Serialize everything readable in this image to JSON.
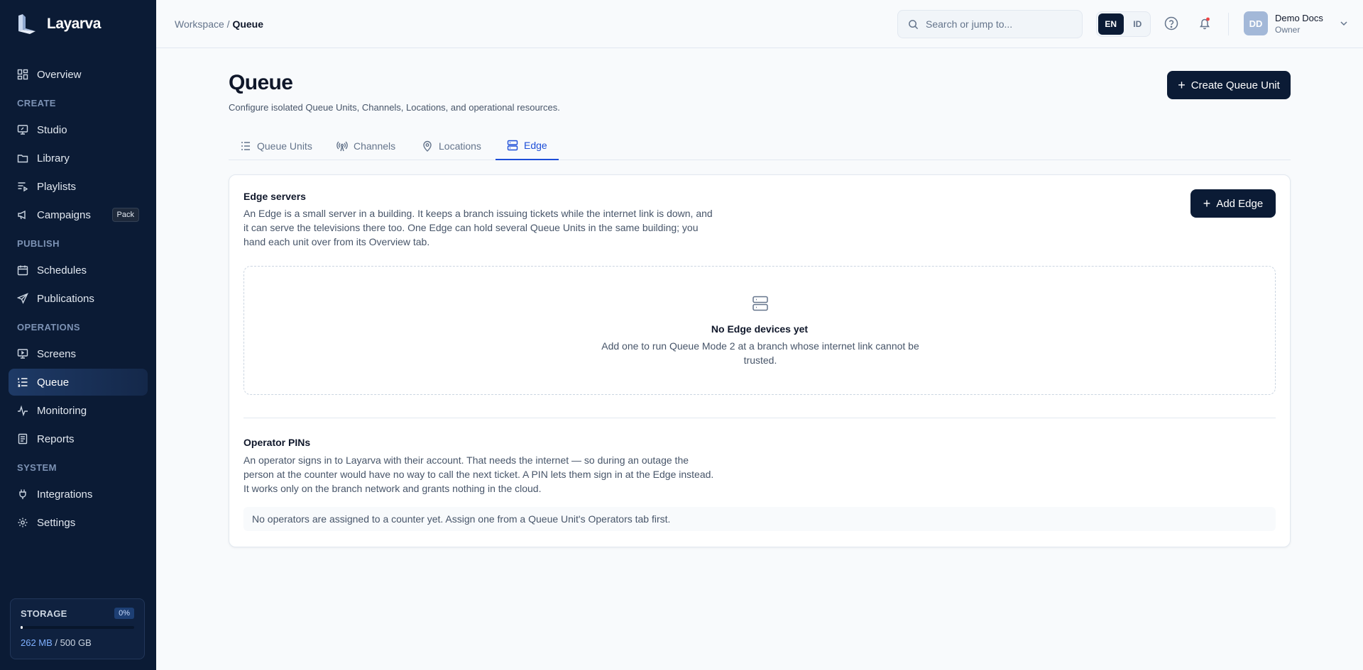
{
  "app": {
    "name": "Layarva"
  },
  "sidebar": {
    "items_top": [
      {
        "label": "Overview",
        "icon": "grid-icon"
      }
    ],
    "sections": [
      {
        "label": "CREATE",
        "items": [
          {
            "label": "Studio",
            "icon": "monitor-edit-icon"
          },
          {
            "label": "Library",
            "icon": "folder-icon"
          },
          {
            "label": "Playlists",
            "icon": "list-play-icon"
          },
          {
            "label": "Campaigns",
            "icon": "megaphone-icon",
            "badge": "Pack"
          }
        ]
      },
      {
        "label": "PUBLISH",
        "items": [
          {
            "label": "Schedules",
            "icon": "calendar-icon"
          },
          {
            "label": "Publications",
            "icon": "send-icon"
          }
        ]
      },
      {
        "label": "OPERATIONS",
        "items": [
          {
            "label": "Screens",
            "icon": "screen-icon"
          },
          {
            "label": "Queue",
            "icon": "list-ordered-icon",
            "active": true
          },
          {
            "label": "Monitoring",
            "icon": "activity-icon"
          },
          {
            "label": "Reports",
            "icon": "report-icon"
          }
        ]
      },
      {
        "label": "SYSTEM",
        "items": [
          {
            "label": "Integrations",
            "icon": "plug-icon"
          },
          {
            "label": "Settings",
            "icon": "gear-icon"
          }
        ]
      }
    ],
    "storage": {
      "label": "STORAGE",
      "percent_label": "0%",
      "fraction": 0.0005,
      "used": "262 MB",
      "separator": " / ",
      "total": "500 GB"
    }
  },
  "header": {
    "breadcrumb": {
      "parent": "Workspace",
      "separator": " / ",
      "current": "Queue"
    },
    "search": {
      "placeholder": "Search or jump to..."
    },
    "languages": [
      "EN",
      "ID"
    ],
    "active_language": "EN",
    "user": {
      "initials": "DD",
      "name": "Demo Docs",
      "role": "Owner"
    }
  },
  "main": {
    "title": "Queue",
    "subtitle": "Configure isolated Queue Units, Channels, Locations, and operational resources.",
    "create_button": "Create Queue Unit",
    "tabs": [
      {
        "label": "Queue Units",
        "icon": "list-icon"
      },
      {
        "label": "Channels",
        "icon": "broadcast-icon"
      },
      {
        "label": "Locations",
        "icon": "map-pin-icon"
      },
      {
        "label": "Edge",
        "icon": "server-icon",
        "active": true
      }
    ],
    "edge": {
      "title": "Edge servers",
      "description": "An Edge is a small server in a building. It keeps a branch issuing tickets while the internet link is down, and it can serve the televisions there too. One Edge can hold several Queue Units in the same building; you hand each unit over from its Overview tab.",
      "add_button": "Add Edge",
      "empty_title": "No Edge devices yet",
      "empty_text": "Add one to run Queue Mode 2 at a branch whose internet link cannot be trusted."
    },
    "pins": {
      "title": "Operator PINs",
      "description": "An operator signs in to Layarva with their account. That needs the internet — so during an outage the person at the counter would have no way to call the next ticket. A PIN lets them sign in at the Edge instead. It works only on the branch network and grants nothing in the cloud.",
      "note": "No operators are assigned to a counter yet. Assign one from a Queue Unit's Operators tab first."
    }
  },
  "colors": {
    "sidebar_bg": "#0b1b35",
    "accent": "#1d4ed8",
    "primary_button": "#0b1b35"
  }
}
